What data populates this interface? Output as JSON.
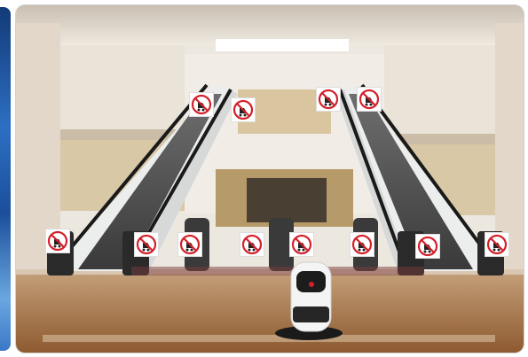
{
  "scene": {
    "subject": "escalator-safety",
    "colors": {
      "ceiling": "#ddd6cb",
      "wall": "#ece8e0",
      "floor": "#a77346",
      "escalator_side": "#e9eaea",
      "handrail": "#1a1a1a",
      "sign_red": "#d3202b",
      "robot_white": "#f4f4f4",
      "robot_dark": "#1c1c1c"
    }
  },
  "signs": [
    {
      "id": "sign-upper-left-1",
      "icon": "no-stroller-icon"
    },
    {
      "id": "sign-upper-left-2",
      "icon": "no-stroller-icon"
    },
    {
      "id": "sign-upper-right-1",
      "icon": "no-stroller-icon"
    },
    {
      "id": "sign-upper-right-2",
      "icon": "no-stroller-icon"
    },
    {
      "id": "sign-lower-1",
      "icon": "no-stroller-icon"
    },
    {
      "id": "sign-lower-2",
      "icon": "no-stroller-icon"
    },
    {
      "id": "sign-lower-3",
      "icon": "no-stroller-icon"
    },
    {
      "id": "sign-lower-4",
      "icon": "no-stroller-icon"
    },
    {
      "id": "sign-lower-5",
      "icon": "no-stroller-icon"
    },
    {
      "id": "sign-lower-6",
      "icon": "no-stroller-icon"
    },
    {
      "id": "sign-lower-7",
      "icon": "no-stroller-icon"
    },
    {
      "id": "sign-lower-8",
      "icon": "no-stroller-icon"
    }
  ]
}
